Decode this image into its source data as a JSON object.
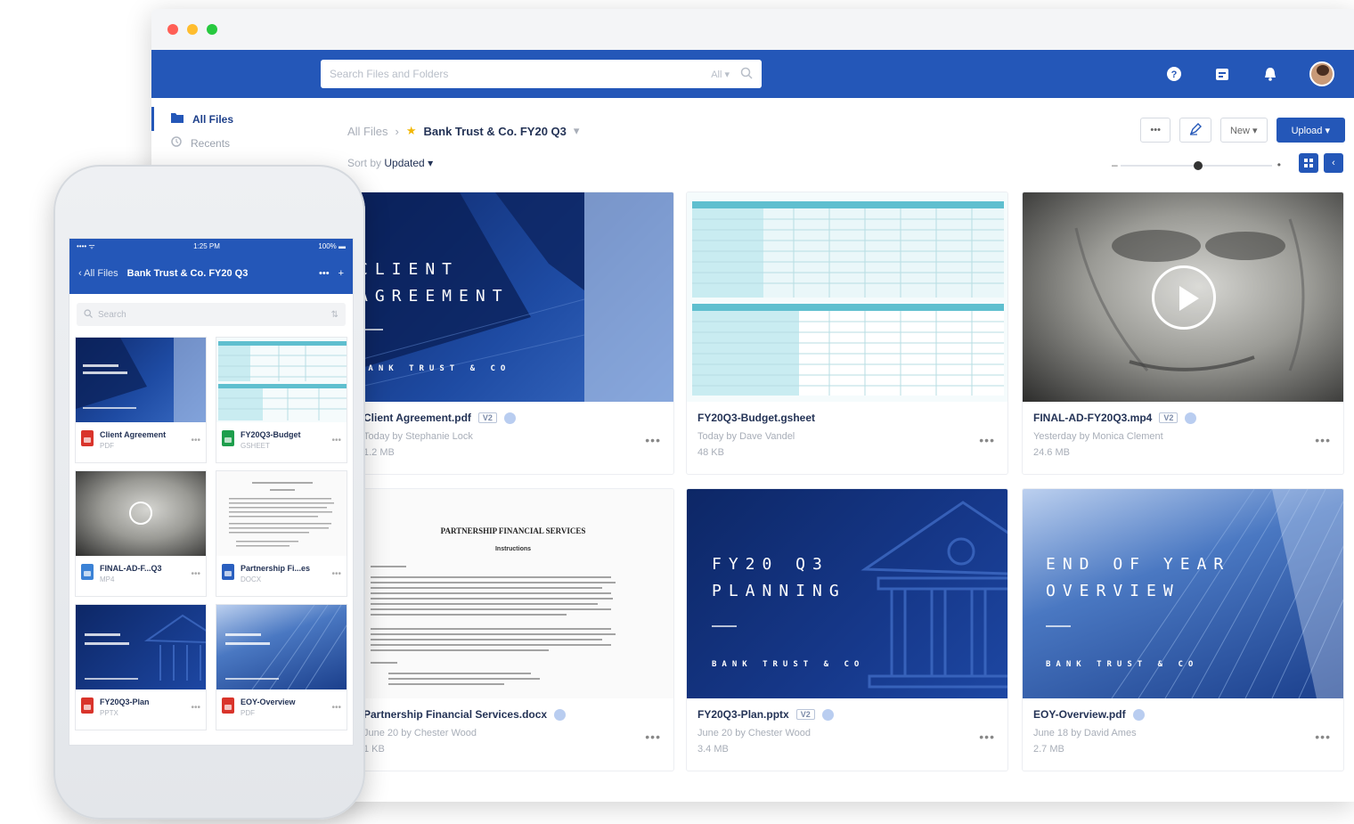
{
  "window": {
    "search_placeholder": "Search Files and Folders",
    "search_filter": "All ▾",
    "nav_icons": [
      "help-icon",
      "updates-icon",
      "bell-icon",
      "avatar"
    ]
  },
  "sidebar": {
    "items": [
      {
        "label": "All Files",
        "icon": "folder-icon",
        "active": true
      },
      {
        "label": "Recents",
        "icon": "clock-icon",
        "active": false
      }
    ]
  },
  "breadcrumb": {
    "root": "All Files",
    "folder": "Bank Trust & Co. FY20 Q3"
  },
  "toolbar": {
    "more": "•••",
    "new_label": "New ▾",
    "upload_label": "Upload ▾"
  },
  "sort": {
    "label": "Sort by",
    "value": "Updated ▾"
  },
  "files": [
    {
      "name": "Client Agreement.pdf",
      "badge": "V2",
      "meta": "Today by Stephanie Lock",
      "size": "1.2 MB",
      "thumb_title": "CLIENT\nAGREEMENT",
      "thumb_sub": "BANK TRUST & CO"
    },
    {
      "name": "FY20Q3-Budget.gsheet",
      "badge": "",
      "meta": "Today by Dave Vandel",
      "size": "48 KB"
    },
    {
      "name": "FINAL-AD-FY20Q3.mp4",
      "badge": "V2",
      "meta": "Yesterday by Monica Clement",
      "size": "24.6 MB"
    },
    {
      "name": "Partnership Financial Services.docx",
      "badge": "",
      "meta": "June 20 by Chester Wood",
      "size": "1 KB",
      "doc_title": "PARTNERSHIP FINANCIAL SERVICES",
      "doc_sub": "Instructions"
    },
    {
      "name": "FY20Q3-Plan.pptx",
      "badge": "V2",
      "meta": "June 20 by Chester Wood",
      "size": "3.4 MB",
      "thumb_title": "FY20 Q3\nPLANNING",
      "thumb_sub": "BANK TRUST & CO"
    },
    {
      "name": "EOY-Overview.pdf",
      "badge": "",
      "meta": "June 18 by David Ames",
      "size": "2.7 MB",
      "thumb_title": "END OF YEAR\nOVERVIEW",
      "thumb_sub": "BANK TRUST & CO"
    }
  ],
  "phone": {
    "status_left": "•••• ᯤ",
    "time": "1:25 PM",
    "status_right": "100% ▬",
    "back_label": "All Files",
    "title": "Bank Trust & Co. FY20 Q3",
    "nav_more": "•••",
    "nav_add": "+",
    "search_placeholder": "Search",
    "files": [
      {
        "name": "Client Agreement",
        "type": "PDF",
        "color": "#d9342b"
      },
      {
        "name": "FY20Q3-Budget",
        "type": "GSHEET",
        "color": "#1e9e4c"
      },
      {
        "name": "FINAL-AD-F...Q3",
        "type": "MP4",
        "color": "#3b82d6"
      },
      {
        "name": "Partnership Fi...es",
        "type": "DOCX",
        "color": "#2a5fbf"
      },
      {
        "name": "FY20Q3-Plan",
        "type": "PPTX",
        "color": "#d9342b"
      },
      {
        "name": "EOY-Overview",
        "type": "PDF",
        "color": "#d9342b"
      }
    ]
  },
  "colors": {
    "brand": "#2457b8",
    "dark_text": "#243356"
  }
}
